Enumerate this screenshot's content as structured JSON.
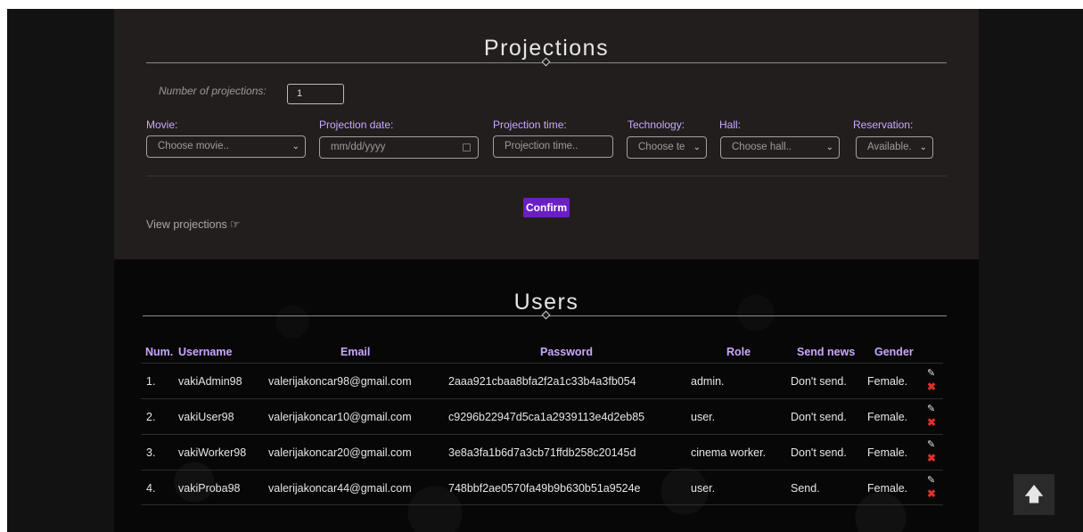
{
  "projections": {
    "title": "Projections",
    "number_label": "Number of projections:",
    "number_value": "1",
    "fields": {
      "movie": {
        "label": "Movie:",
        "placeholder": "Choose movie.."
      },
      "date": {
        "label": "Projection date:",
        "placeholder": "mm/dd/yyyy"
      },
      "time": {
        "label": "Projection time:",
        "placeholder": "Projection time.."
      },
      "technology": {
        "label": "Technology:",
        "placeholder": "Choose te"
      },
      "hall": {
        "label": "Hall:",
        "placeholder": "Choose hall.."
      },
      "reservation": {
        "label": "Reservation:",
        "value": "Available."
      }
    },
    "confirm_label": "Confirm",
    "view_link": "View projections"
  },
  "users": {
    "title": "Users",
    "columns": [
      "Num.",
      "Username",
      "Email",
      "Password",
      "Role",
      "Send news",
      "Gender"
    ],
    "rows": [
      {
        "num": "1.",
        "username": "vakiAdmin98",
        "email": "valerijakoncar98@gmail.com",
        "password": "2aaa921cbaa8bfa2f2a1c33b4a3fb054",
        "role": "admin.",
        "send_news": "Don't send.",
        "gender": "Female."
      },
      {
        "num": "2.",
        "username": "vakiUser98",
        "email": "valerijakoncar10@gmail.com",
        "password": "c9296b22947d5ca1a2939113e4d2eb85",
        "role": "user.",
        "send_news": "Don't send.",
        "gender": "Female."
      },
      {
        "num": "3.",
        "username": "vakiWorker98",
        "email": "valerijakoncar20@gmail.com",
        "password": "3e8a3fa1b6d7a3cb71ffdb258c20145d",
        "role": "cinema worker.",
        "send_news": "Don't send.",
        "gender": "Female."
      },
      {
        "num": "4.",
        "username": "vakiProba98",
        "email": "valerijakoncar44@gmail.com",
        "password": "748bbf2ae0570fa49b9b630b51a9524e",
        "role": "user.",
        "send_news": "Send.",
        "gender": "Female."
      }
    ]
  },
  "icons": {
    "edit": "edit-icon",
    "delete": "delete-icon",
    "view": "hand-pointer-icon",
    "scroll_top": "arrow-up-icon"
  },
  "colors": {
    "accent": "#6a1fc5",
    "label": "#c9a8ff",
    "delete": "#e0302c"
  }
}
